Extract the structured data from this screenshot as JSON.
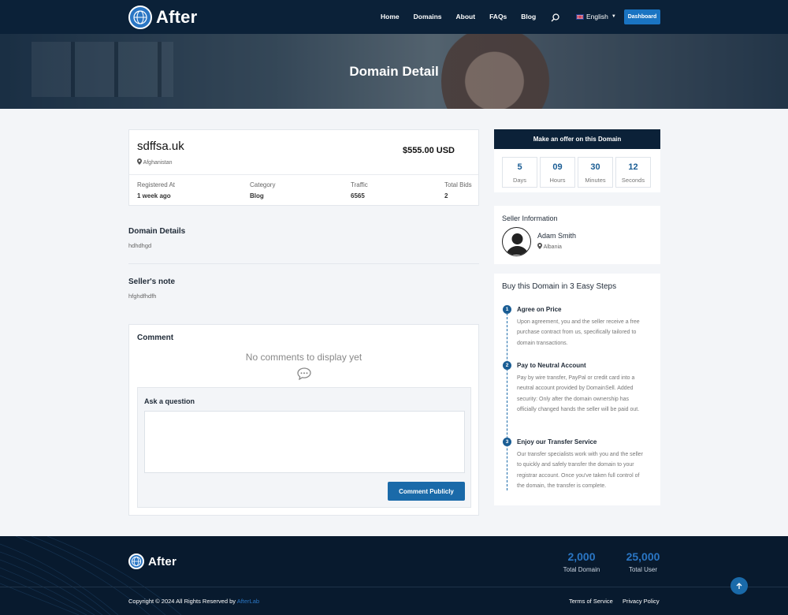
{
  "header": {
    "logo_text": "After",
    "nav": [
      "Home",
      "Domains",
      "About",
      "FAQs",
      "Blog"
    ],
    "language": "English",
    "dashboard_label": "Dashboard"
  },
  "hero": {
    "title": "Domain Detail"
  },
  "domain": {
    "name": "sdffsa.uk",
    "location": "Afghanistan",
    "price": "$555.00 USD",
    "meta": [
      {
        "label": "Registered At",
        "value": "1 week ago"
      },
      {
        "label": "Category",
        "value": "Blog"
      },
      {
        "label": "Traffic",
        "value": "6565"
      },
      {
        "label": "Total Bids",
        "value": "2"
      }
    ]
  },
  "details": {
    "title": "Domain Details",
    "text": "hdhdhgd"
  },
  "seller_note": {
    "title": "Seller's note",
    "text": "hfghdfhdfh"
  },
  "comments": {
    "title": "Comment",
    "empty_text": "No comments to display yet",
    "ask_title": "Ask a question",
    "textarea_value": "",
    "button_label": "Comment Publicly"
  },
  "offer": {
    "header": "Make an offer on this Domain",
    "timer": [
      {
        "value": "5",
        "unit": "Days"
      },
      {
        "value": "09",
        "unit": "Hours"
      },
      {
        "value": "30",
        "unit": "Minutes"
      },
      {
        "value": "12",
        "unit": "Seconds"
      }
    ]
  },
  "seller": {
    "title": "Seller Information",
    "name": "Adam Smith",
    "location": "Albania"
  },
  "steps": {
    "title": "Buy this Domain in 3 Easy Steps",
    "items": [
      {
        "num": "1",
        "title": "Agree on Price",
        "text": "Upon agreement, you and the seller receive a free purchase contract from us, specifically tailored to domain transactions."
      },
      {
        "num": "2",
        "title": "Pay to Neutral Account",
        "text": "Pay by wire transfer, PayPal or credit card into a neutral account provided by DomainSell. Added security: Only after the domain ownership has officially changed hands the seller will be paid out."
      },
      {
        "num": "3",
        "title": "Enjoy our Transfer Service",
        "text": "Our transfer specialists work with you and the seller to quickly and safely transfer the domain to your registrar account. Once you've taken full control of the domain, the transfer is complete."
      }
    ]
  },
  "footer": {
    "logo_text": "After",
    "stats": [
      {
        "value": "2,000",
        "label": "Total Domain"
      },
      {
        "value": "25,000",
        "label": "Total User"
      }
    ],
    "copyright_prefix": "Copyright © 2024 All Rights Reserved by",
    "copyright_link": "AfterLab",
    "links": [
      "Terms of Service",
      "Privacy Policy"
    ]
  },
  "colors": {
    "navy": "#0b2138",
    "accent": "#1a6aa9",
    "stat_blue": "#2a76c4"
  },
  "icons": [
    "globe-logo-icon",
    "search-icon",
    "uk-flag-icon",
    "map-pin-icon",
    "chat-bubble-icon",
    "user-avatar-icon",
    "arrow-up-icon"
  ]
}
